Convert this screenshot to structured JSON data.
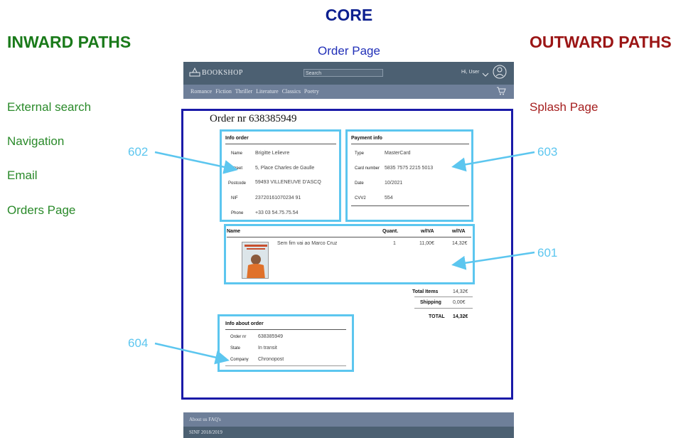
{
  "titles": {
    "core": "CORE",
    "inward": "INWARD PATHS",
    "outward": "OUTWARD PATHS",
    "page": "Order Page"
  },
  "inward_paths": [
    "External search",
    "Navigation",
    "Email",
    "Orders Page"
  ],
  "outward_paths": [
    "Splash Page"
  ],
  "callouts": {
    "c601": "601",
    "c602": "602",
    "c603": "603",
    "c604": "604"
  },
  "mockup": {
    "logo": "BOOKSHOP",
    "search_placeholder": "Search",
    "user": "Hi, User",
    "nav": "Romance Fiction Thriller Literature Classics Poetry",
    "order_title": "Order nr 638385949",
    "info_order": {
      "heading": "Info order",
      "rows": [
        {
          "label": "Name",
          "value": "Brigitte Lelievre"
        },
        {
          "label": "Street",
          "value": "5, Place Charles de Gaulle"
        },
        {
          "label": "Postcode",
          "value": "59493 VILLENEUVE D'ASCQ"
        },
        {
          "label": "NIF",
          "value": "23720161070234 91"
        },
        {
          "label": "Phone",
          "value": "+33 03 54.75.75.54"
        }
      ]
    },
    "payment_info": {
      "heading": "Payment info",
      "rows": [
        {
          "label": "Type",
          "value": "MasterCard"
        },
        {
          "label": "Card number",
          "value": "5835 7575 2215 5013"
        },
        {
          "label": "Date",
          "value": "10/2021"
        },
        {
          "label": "CVV2",
          "value": "554"
        }
      ]
    },
    "items": {
      "headers": {
        "name": "Name",
        "quant": "Quant.",
        "wo_iva": "w/IVA",
        "w_iva": "w/IVA"
      },
      "row": {
        "title": "Sem fim vai ao Marco Cruz",
        "quant": "1",
        "wo_iva": "11,00€",
        "w_iva": "14,32€"
      }
    },
    "totals": {
      "items_label": "Total Items",
      "items_value": "14,32€",
      "shipping_label": "Shipping",
      "shipping_value": "0,00€",
      "total_label": "TOTAL",
      "total_value": "14,32€"
    },
    "about_order": {
      "heading": "Info about order",
      "rows": [
        {
          "label": "Order nr",
          "value": "638385949"
        },
        {
          "label": "State",
          "value": "In transit"
        },
        {
          "label": "Company",
          "value": "Chronopost"
        }
      ]
    },
    "footer": {
      "links": "About us  FAQ's",
      "copyright": "SINF 2018/2019"
    }
  }
}
